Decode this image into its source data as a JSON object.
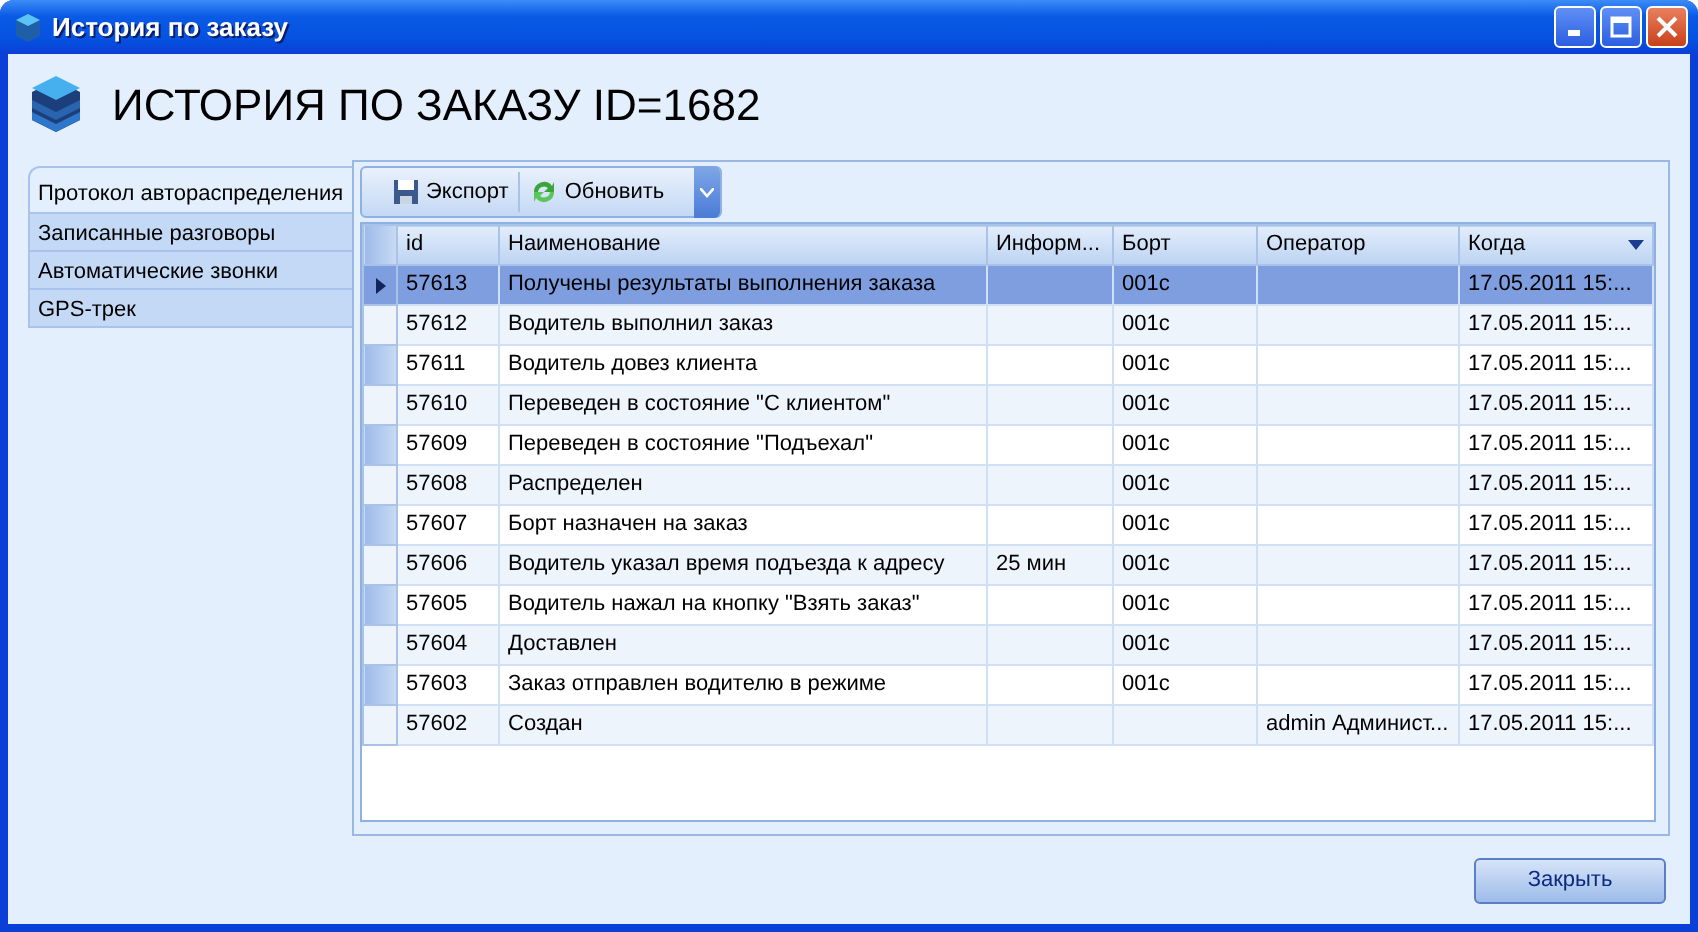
{
  "window": {
    "title": "История по заказу"
  },
  "heading": "ИСТОРИЯ ПО ЗАКАЗУ ID=1682",
  "tabs": [
    {
      "label": "Протокол автораспределения",
      "selected": true
    },
    {
      "label": "Записанные разговоры",
      "selected": false
    },
    {
      "label": "Автоматические звонки",
      "selected": false
    },
    {
      "label": "GPS-трек",
      "selected": false
    }
  ],
  "toolbar": [
    {
      "label": "Экспорт",
      "kind": "save"
    },
    {
      "label": "Обновить",
      "kind": "refresh"
    }
  ],
  "table": {
    "columns": [
      {
        "label": "id",
        "sorted": false
      },
      {
        "label": "Наименование",
        "sorted": false
      },
      {
        "label": "Информ...",
        "sorted": false
      },
      {
        "label": "Борт",
        "sorted": false
      },
      {
        "label": "Оператор",
        "sorted": false
      },
      {
        "label": "Когда",
        "sorted": true
      }
    ],
    "rows": [
      {
        "selected": true,
        "cells": [
          "57613",
          "Получены результаты выполнения заказа",
          "",
          "001c",
          "",
          "17.05.2011 15:..."
        ]
      },
      {
        "selected": false,
        "cells": [
          "57612",
          "Водитель выполнил заказ",
          "",
          "001c",
          "",
          "17.05.2011 15:..."
        ]
      },
      {
        "selected": false,
        "cells": [
          "57611",
          "Водитель довез клиента",
          "",
          "001c",
          "",
          "17.05.2011 15:..."
        ]
      },
      {
        "selected": false,
        "cells": [
          "57610",
          "Переведен в состояние \"С клиентом\"",
          "",
          "001c",
          "",
          "17.05.2011 15:..."
        ]
      },
      {
        "selected": false,
        "cells": [
          "57609",
          "Переведен в состояние \"Подъехал\"",
          "",
          "001c",
          "",
          "17.05.2011 15:..."
        ]
      },
      {
        "selected": false,
        "cells": [
          "57608",
          "Распределен",
          "",
          "001c",
          "",
          "17.05.2011 15:..."
        ]
      },
      {
        "selected": false,
        "cells": [
          "57607",
          "Борт назначен на заказ",
          "",
          "001c",
          "",
          "17.05.2011 15:..."
        ]
      },
      {
        "selected": false,
        "cells": [
          "57606",
          "Водитель указал время подъезда к адресу",
          "25 мин",
          "001c",
          "",
          "17.05.2011 15:..."
        ]
      },
      {
        "selected": false,
        "cells": [
          "57605",
          "Водитель нажал на кнопку \"Взять заказ\"",
          "",
          "001c",
          "",
          "17.05.2011 15:..."
        ]
      },
      {
        "selected": false,
        "cells": [
          "57604",
          "Доставлен",
          "",
          "001c",
          "",
          "17.05.2011 15:..."
        ]
      },
      {
        "selected": false,
        "cells": [
          "57603",
          "Заказ отправлен водителю в режиме",
          "",
          "001c",
          "",
          "17.05.2011 15:..."
        ]
      },
      {
        "selected": false,
        "cells": [
          "57602",
          "Создан",
          "",
          "",
          "admin Админист...",
          "17.05.2011 15:..."
        ]
      }
    ]
  },
  "close_button": "Закрыть"
}
